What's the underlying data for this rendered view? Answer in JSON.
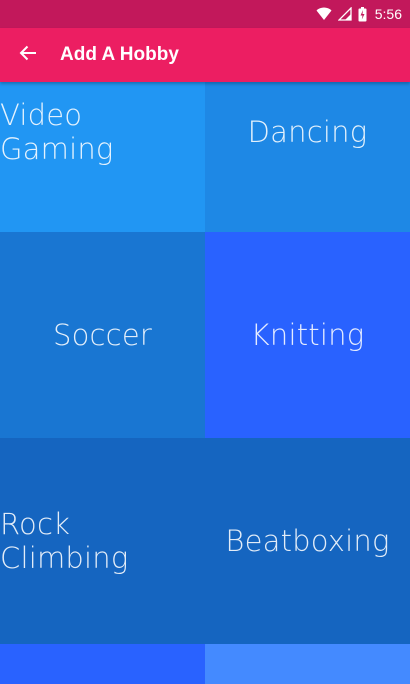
{
  "status_bar": {
    "time": "5:56",
    "icons": [
      "wifi-icon",
      "signal-icon",
      "battery-charging-icon"
    ]
  },
  "app_bar": {
    "title": "Add A Hobby",
    "back_icon": "arrow-left-icon"
  },
  "colors": {
    "status_bar": "#c2185b",
    "app_bar": "#ec1e62"
  },
  "hobbies": [
    {
      "label": "Video Gaming",
      "color": "#2196f3"
    },
    {
      "label": "Dancing",
      "color": "#1e88e5"
    },
    {
      "label": "Soccer",
      "color": "#1976d2"
    },
    {
      "label": "Knitting",
      "color": "#2962ff"
    },
    {
      "label": "Rock Climbing",
      "color": "#1565c0"
    },
    {
      "label": "Beatboxing",
      "color": "#1565c0"
    },
    {
      "label": "",
      "color": "#2962ff"
    },
    {
      "label": "",
      "color": "#448aff"
    }
  ]
}
